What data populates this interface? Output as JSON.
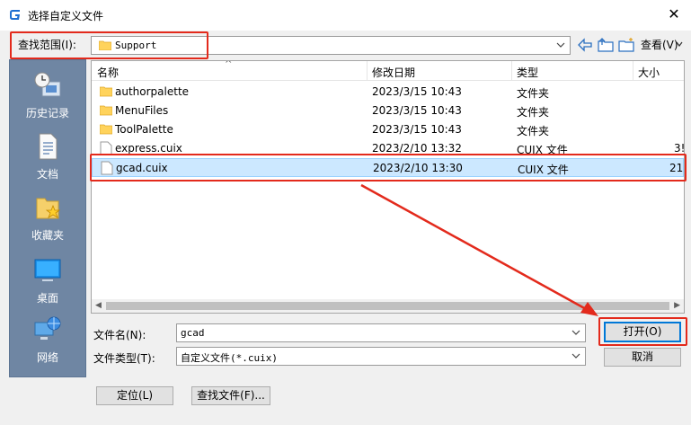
{
  "window": {
    "title": "选择自定义文件",
    "close_glyph": "✕"
  },
  "lookin": {
    "label": "查找范围(I):",
    "value": "Support"
  },
  "toolbar": {
    "views_label": "查看(V)"
  },
  "places": [
    {
      "label": "历史记录",
      "icon": "history-icon"
    },
    {
      "label": "文档",
      "icon": "documents-icon"
    },
    {
      "label": "收藏夹",
      "icon": "favorites-icon"
    },
    {
      "label": "桌面",
      "icon": "desktop-icon"
    },
    {
      "label": "网络",
      "icon": "network-icon"
    }
  ],
  "filelist": {
    "columns": [
      "名称",
      "修改日期",
      "类型",
      "大小"
    ],
    "rows": [
      {
        "name": "authorpalette",
        "date": "2023/3/15 10:43",
        "type": "文件夹",
        "size": "",
        "icon": "folder-icon"
      },
      {
        "name": "MenuFiles",
        "date": "2023/3/15 10:43",
        "type": "文件夹",
        "size": "",
        "icon": "folder-icon"
      },
      {
        "name": "ToolPalette",
        "date": "2023/3/15 10:43",
        "type": "文件夹",
        "size": "",
        "icon": "folder-icon"
      },
      {
        "name": "express.cuix",
        "date": "2023/2/10 13:32",
        "type": "CUIX 文件",
        "size": "3!",
        "icon": "file-icon"
      },
      {
        "name": "gcad.cuix",
        "date": "2023/2/10 13:30",
        "type": "CUIX 文件",
        "size": "21(",
        "icon": "file-icon",
        "selected": true
      }
    ]
  },
  "filename": {
    "label": "文件名(N):",
    "value": "gcad"
  },
  "filetype": {
    "label": "文件类型(T):",
    "value": "自定义文件(*.cuix)"
  },
  "buttons": {
    "open": "打开(O)",
    "cancel": "取消",
    "locate": "定位(L)",
    "find": "查找文件(F)..."
  },
  "colors": {
    "highlight": "#e32a1c",
    "places_bg": "#6f86a3",
    "selection": "#cce8ff"
  }
}
